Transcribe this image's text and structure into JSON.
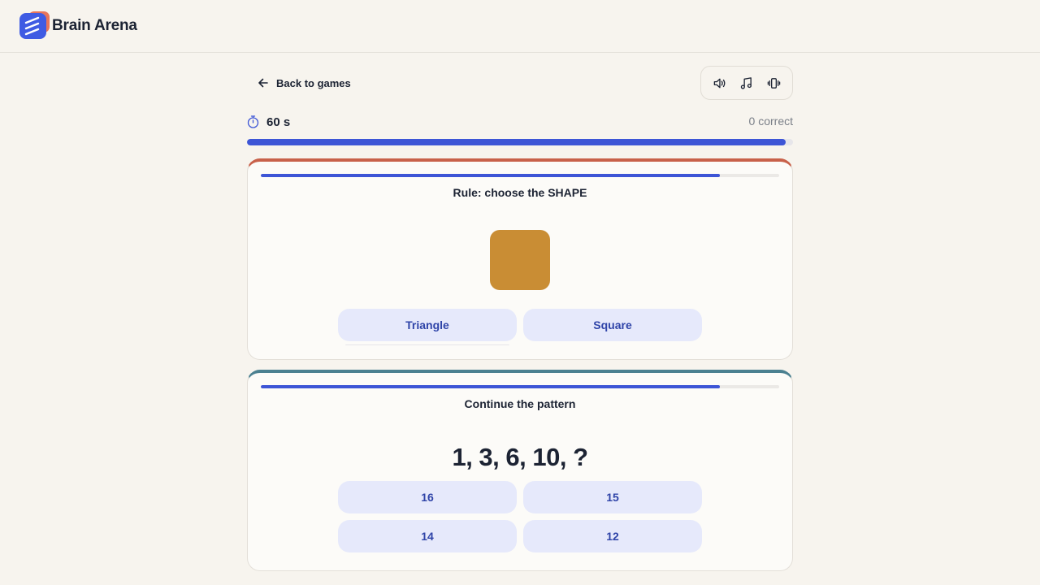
{
  "app": {
    "name": "Brain Arena"
  },
  "nav": {
    "back_label": "Back to games"
  },
  "controls": [
    {
      "name": "sound-icon"
    },
    {
      "name": "music-icon"
    },
    {
      "name": "vibration-icon"
    }
  ],
  "status": {
    "time_left": "60 s",
    "score_text": "0 correct",
    "time_progress": 0.987
  },
  "cards": {
    "rule": {
      "title": "Rule: choose the SHAPE",
      "round_progress": 0.885,
      "stimulus_color": "#c98d34",
      "stimulus_shape": "square",
      "answers": [
        "Triangle",
        "Square"
      ]
    },
    "pattern": {
      "title": "Continue the pattern",
      "round_progress": 0.885,
      "sequence": "1, 3, 6, 10, ?",
      "answers": [
        "16",
        "15",
        "14",
        "12"
      ]
    }
  },
  "colors": {
    "accent": "#3d55d6",
    "rule_card_accent": "#c8614a",
    "pattern_card_accent": "#4b8090",
    "answer_bg": "#e6e9fb",
    "answer_text": "#2f44a8"
  }
}
